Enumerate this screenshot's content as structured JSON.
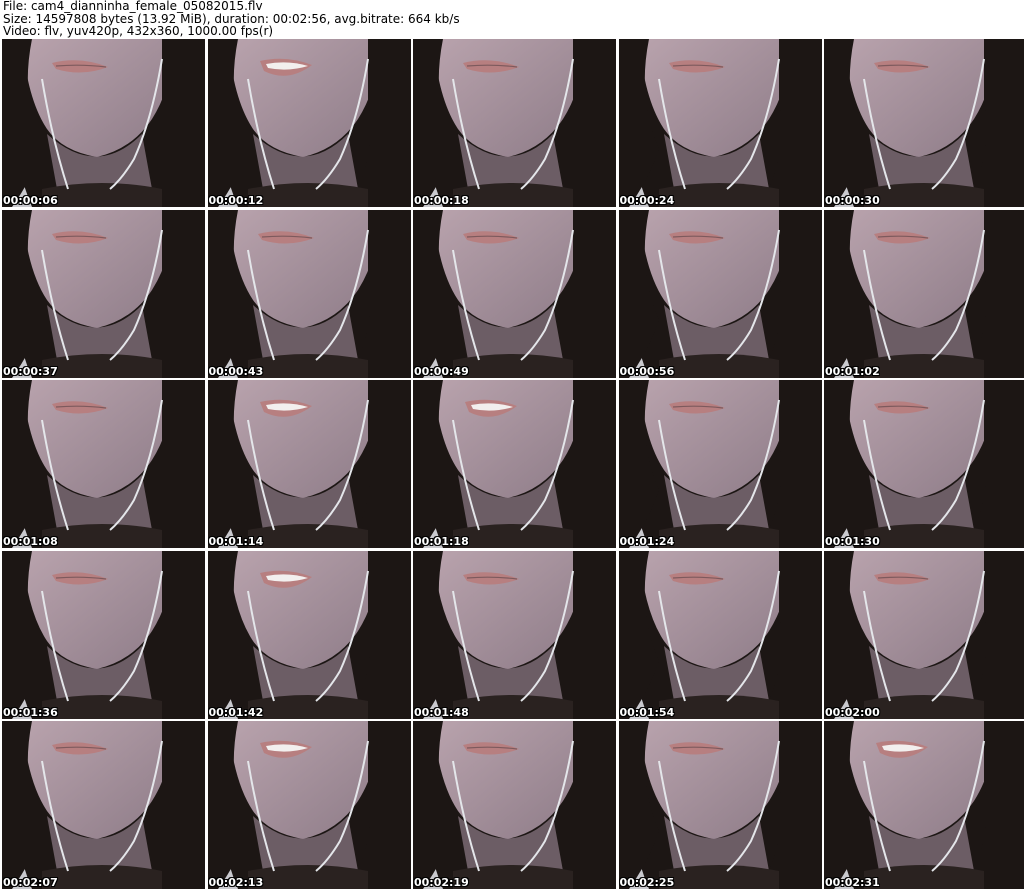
{
  "header": {
    "line1": "File: cam4_dianninha_female_05082015.flv",
    "line2": "Size: 14597808 bytes (13.92 MiB), duration: 00:02:56, avg.bitrate: 664 kb/s",
    "line3": "Video: flv, yuv420p, 432x360, 1000.00 fps(r)"
  },
  "frames": [
    {
      "timestamp": "00:00:06",
      "smile": false
    },
    {
      "timestamp": "00:00:12",
      "smile": true
    },
    {
      "timestamp": "00:00:18",
      "smile": false
    },
    {
      "timestamp": "00:00:24",
      "smile": false
    },
    {
      "timestamp": "00:00:30",
      "smile": false
    },
    {
      "timestamp": "00:00:37",
      "smile": false
    },
    {
      "timestamp": "00:00:43",
      "smile": false
    },
    {
      "timestamp": "00:00:49",
      "smile": false
    },
    {
      "timestamp": "00:00:56",
      "smile": false
    },
    {
      "timestamp": "00:01:02",
      "smile": false
    },
    {
      "timestamp": "00:01:08",
      "smile": false
    },
    {
      "timestamp": "00:01:14",
      "smile": true
    },
    {
      "timestamp": "00:01:18",
      "smile": true
    },
    {
      "timestamp": "00:01:24",
      "smile": false
    },
    {
      "timestamp": "00:01:30",
      "smile": false
    },
    {
      "timestamp": "00:01:36",
      "smile": false
    },
    {
      "timestamp": "00:01:42",
      "smile": true
    },
    {
      "timestamp": "00:01:48",
      "smile": false
    },
    {
      "timestamp": "00:01:54",
      "smile": false
    },
    {
      "timestamp": "00:02:00",
      "smile": false
    },
    {
      "timestamp": "00:02:07",
      "smile": false
    },
    {
      "timestamp": "00:02:13",
      "smile": true
    },
    {
      "timestamp": "00:02:19",
      "smile": false
    },
    {
      "timestamp": "00:02:25",
      "smile": false
    },
    {
      "timestamp": "00:02:31",
      "smile": true
    }
  ],
  "colors": {
    "skin": "#b9a3ad",
    "skin_shadow": "#8e7c88",
    "hair": "#1c1614",
    "lips": "#b77f80",
    "teeth": "#f2efee",
    "cable": "#e4e6ea",
    "background_white": "#e8e9ee"
  }
}
